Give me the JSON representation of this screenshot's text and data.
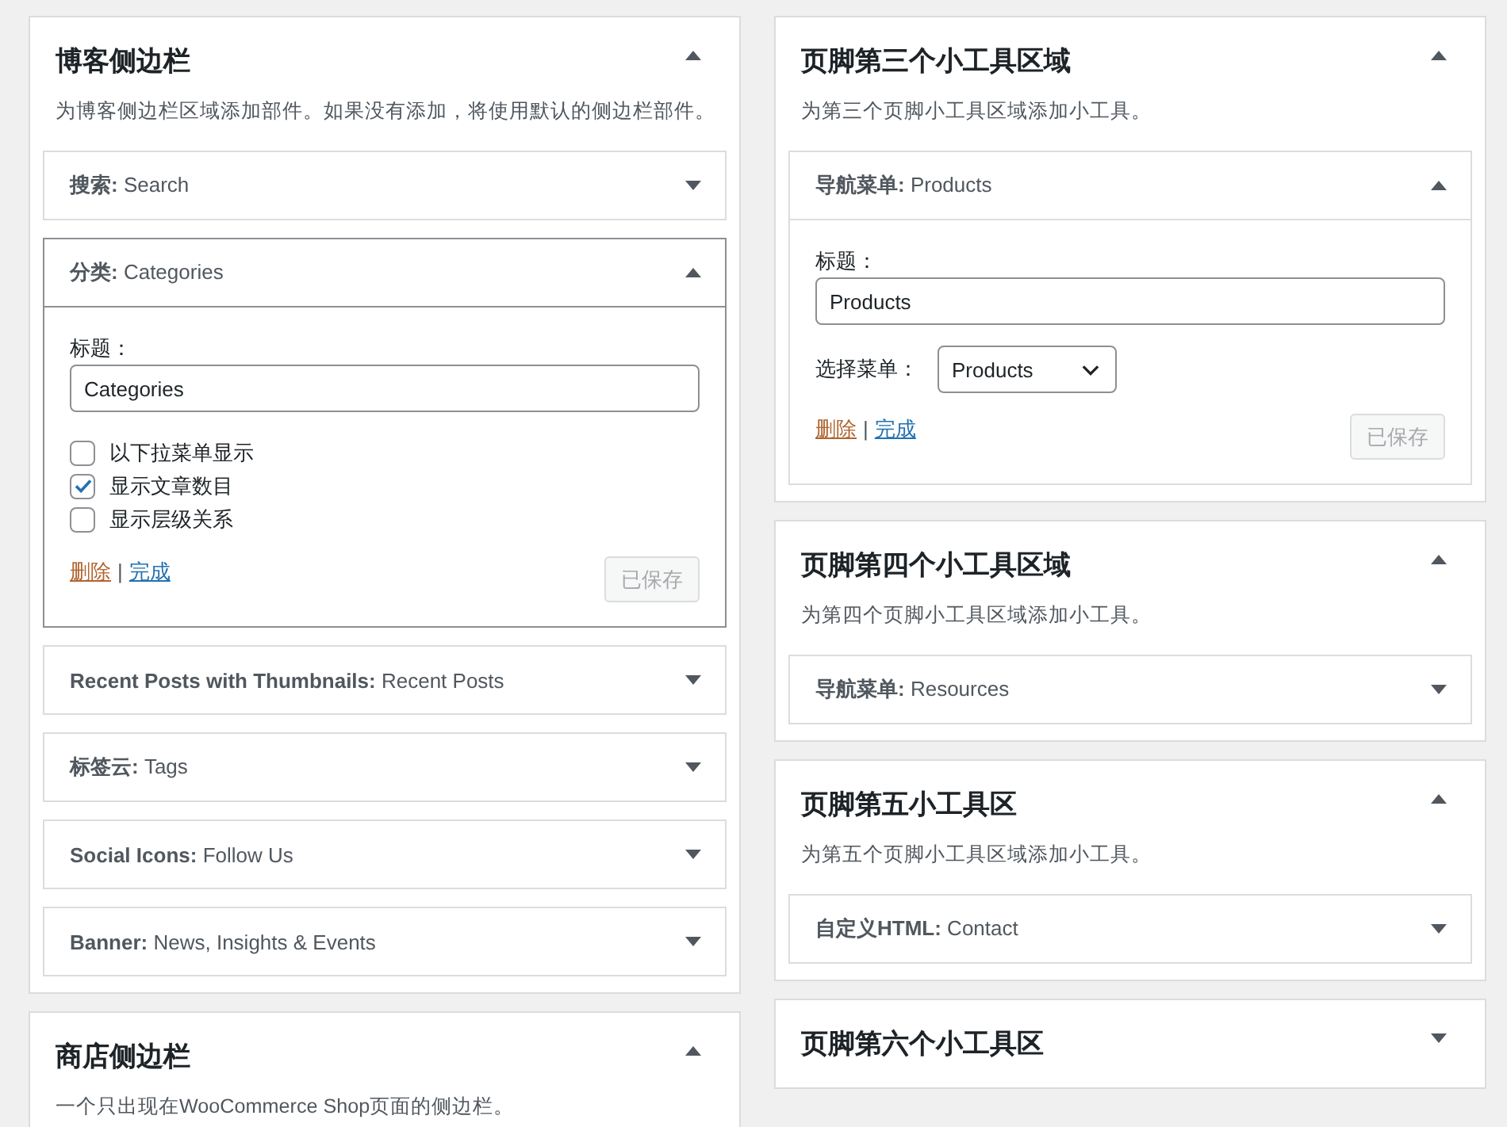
{
  "columns": [
    {
      "areas": [
        {
          "title": "博客侧边栏",
          "expanded": true,
          "description": "为博客侧边栏区域添加部件。如果没有添加，将使用默认的侧边栏部件。",
          "widgets": [
            {
              "heading": "**搜索:** Search",
              "expanded": false,
              "focused": false
            },
            {
              "heading": "**分类:** Categories",
              "expanded": true,
              "focused": true,
              "title_label": "标题：",
              "title_value": "Categories",
              "options": [
                {
                  "label": "以下拉菜单显示",
                  "checked": false
                },
                {
                  "label": "显示文章数目",
                  "checked": true
                },
                {
                  "label": "显示层级关系",
                  "checked": false
                }
              ],
              "delete_link": "删除",
              "separator": "|",
              "done_link": "完成",
              "save_button": {
                "label": "已保存",
                "disabled": true
              }
            },
            {
              "heading": "**Recent Posts with Thumbnails:** Recent Posts",
              "expanded": false,
              "focused": false
            },
            {
              "heading": "**标签云:** Tags",
              "expanded": false,
              "focused": false
            },
            {
              "heading": "**Social Icons:** Follow Us",
              "expanded": false,
              "focused": false
            },
            {
              "heading": "**Banner:** News, Insights & Events",
              "expanded": false,
              "focused": false
            }
          ]
        },
        {
          "title": "商店侧边栏",
          "expanded": true,
          "description": "一个只出现在WooCommerce Shop页面的侧边栏。"
        }
      ]
    },
    {
      "areas": [
        {
          "title": "页脚第三个小工具区域",
          "expanded": true,
          "description": "为第三个页脚小工具区域添加小工具。",
          "widgets": [
            {
              "heading": "**导航菜单:** Products",
              "expanded": true,
              "focused": false,
              "title_label": "标题：",
              "title_value": "Products",
              "menu_select": {
                "label": "选择菜单：",
                "value": "Products"
              },
              "delete_link": "删除",
              "separator": "|",
              "done_link": "完成",
              "save_button": {
                "label": "已保存",
                "disabled": true
              }
            }
          ]
        },
        {
          "title": "页脚第四个小工具区域",
          "expanded": true,
          "description": "为第四个页脚小工具区域添加小工具。",
          "widgets": [
            {
              "heading": "**导航菜单:** Resources",
              "expanded": false,
              "focused": false
            }
          ]
        },
        {
          "title": "页脚第五小工具区",
          "expanded": true,
          "description": "为第五个页脚小工具区域添加小工具。",
          "widgets": [
            {
              "heading": "**自定义HTML:** Contact",
              "expanded": false,
              "focused": false
            }
          ]
        },
        {
          "title": "页脚第六个小工具区",
          "expanded": false
        }
      ]
    }
  ]
}
